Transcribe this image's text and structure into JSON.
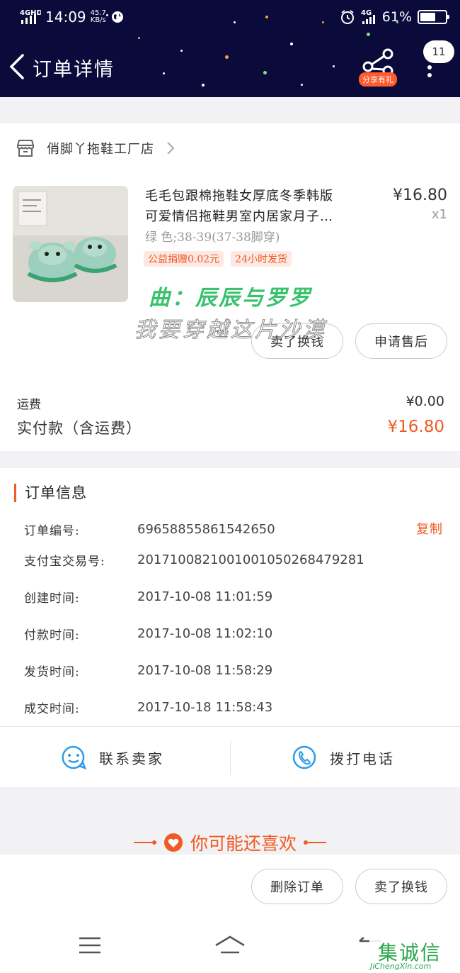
{
  "status_bar": {
    "network": "4GHD",
    "time": "14:09",
    "speed_value": "45.7",
    "speed_unit": "KB/s",
    "net_right": "4G",
    "battery": "61%",
    "battery_level": 0.61
  },
  "header": {
    "title": "订单详情",
    "share_badge": "分享有礼",
    "message_count": "11"
  },
  "shop": {
    "name": "俏脚丫拖鞋工厂店"
  },
  "product": {
    "title_line1": "毛毛包跟棉拖鞋女厚底冬季韩版",
    "title_line2": "可爱情侣拖鞋男室内居家月子…",
    "price": "¥16.80",
    "quantity": "x1",
    "sku": "绿  色;38-39(37-38脚穿)",
    "tags": [
      "公益捐赠0.02元",
      "24小时发货"
    ]
  },
  "watermark": {
    "line1": "曲：辰辰与罗罗",
    "line2": "我要穿越这片沙漠"
  },
  "item_actions": {
    "exchange": "卖了换钱",
    "after_sale": "申请售后"
  },
  "fees": {
    "shipping_label": "运费",
    "shipping_value": "¥0.00",
    "paid_label": "实付款（含运费）",
    "paid_value": "¥16.80"
  },
  "order_info": {
    "title": "订单信息",
    "copy": "复制",
    "rows": [
      {
        "label": "订单编号:",
        "value": "69658855861542650"
      },
      {
        "label": "支付宝交易号:",
        "value": "2017100821001001050268479281"
      },
      {
        "label": "创建时间:",
        "value": "2017-10-08 11:01:59"
      },
      {
        "label": "付款时间:",
        "value": "2017-10-08 11:02:10"
      },
      {
        "label": "发货时间:",
        "value": "2017-10-08 11:58:29"
      },
      {
        "label": "成交时间:",
        "value": "2017-10-18 11:58:43"
      }
    ]
  },
  "contact": {
    "seller": "联系卖家",
    "phone": "拨打电话"
  },
  "recommend": {
    "title": "你可能还喜欢"
  },
  "bottom_actions": {
    "delete": "删除订单",
    "exchange": "卖了换钱"
  },
  "site_logo": {
    "chars": "集诚信",
    "url": "JiChengXin.com"
  },
  "colors": {
    "header_bg": "#0a0b3a",
    "accent": "#f05a24",
    "icon_blue": "#2f9be8"
  }
}
